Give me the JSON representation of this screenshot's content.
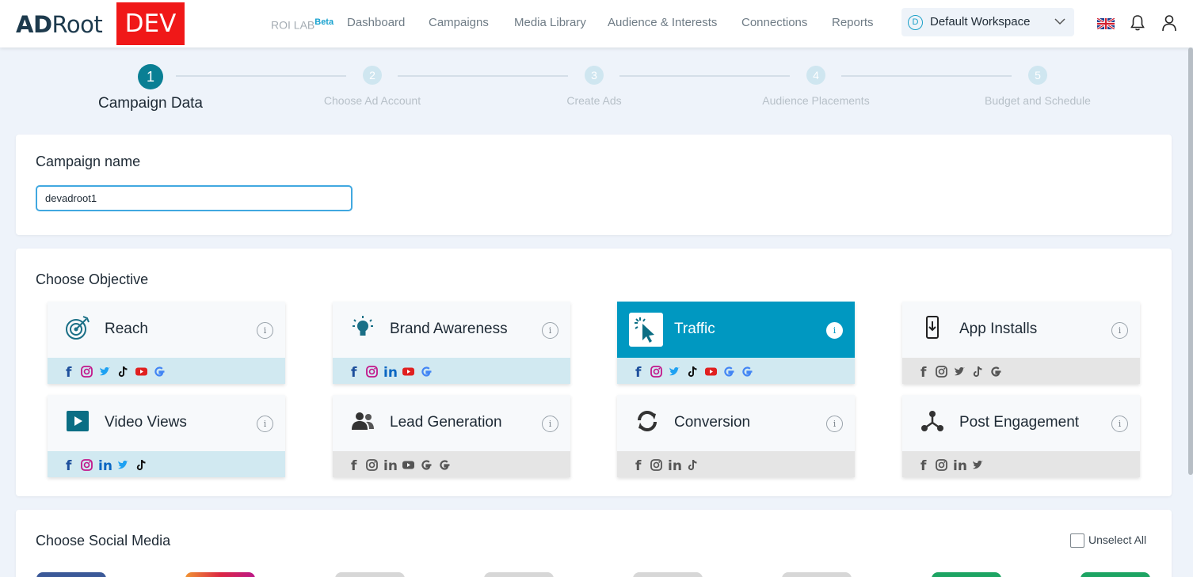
{
  "header": {
    "logo": "ADRoot",
    "env_badge": "DEV",
    "roi_lab": "ROI LAB",
    "roi_lab_badge": "Beta",
    "nav": [
      "Dashboard",
      "Campaigns",
      "Media Library",
      "Audience & Interests",
      "Connections",
      "Reports"
    ],
    "workspace_initial": "D",
    "workspace": "Default Workspace",
    "language_icon": "uk-flag-icon",
    "notifications_icon": "bell-icon",
    "account_icon": "user-icon"
  },
  "stepper": [
    {
      "number": "1",
      "label": "Campaign Data",
      "active": true
    },
    {
      "number": "2",
      "label": "Choose Ad Account",
      "active": false
    },
    {
      "number": "3",
      "label": "Create Ads",
      "active": false
    },
    {
      "number": "4",
      "label": "Audience Placements",
      "active": false
    },
    {
      "number": "5",
      "label": "Budget and Schedule",
      "active": false
    }
  ],
  "campaign_name": {
    "title": "Campaign name",
    "value": "devadroot1"
  },
  "objective": {
    "title": "Choose Objective",
    "info_glyph": "i",
    "items": [
      {
        "label": "Reach",
        "icon": "target-icon",
        "selected": false,
        "platforms": [
          "facebook",
          "instagram",
          "twitter",
          "tiktok",
          "youtube",
          "google"
        ],
        "active": true
      },
      {
        "label": "Brand Awareness",
        "icon": "lightbulb-icon",
        "selected": false,
        "platforms": [
          "facebook",
          "instagram",
          "linkedin",
          "youtube",
          "google"
        ],
        "active": true
      },
      {
        "label": "Traffic",
        "icon": "cursor-click-icon",
        "selected": true,
        "platforms": [
          "facebook",
          "instagram",
          "twitter",
          "tiktok",
          "youtube",
          "google",
          "google"
        ],
        "active": true
      },
      {
        "label": "App Installs",
        "icon": "mobile-download-icon",
        "selected": false,
        "platforms": [
          "facebook",
          "instagram",
          "twitter",
          "tiktok",
          "google"
        ],
        "active": false
      },
      {
        "label": "Video Views",
        "icon": "video-play-icon",
        "selected": false,
        "platforms": [
          "facebook",
          "instagram",
          "linkedin",
          "twitter",
          "tiktok"
        ],
        "active": true
      },
      {
        "label": "Lead Generation",
        "icon": "users-icon",
        "selected": false,
        "platforms": [
          "facebook",
          "instagram",
          "linkedin",
          "youtube",
          "google",
          "google"
        ],
        "active": false
      },
      {
        "label": "Conversion",
        "icon": "sync-icon",
        "selected": false,
        "platforms": [
          "facebook",
          "instagram",
          "linkedin",
          "tiktok"
        ],
        "active": false
      },
      {
        "label": "Post Engagement",
        "icon": "share-nodes-icon",
        "selected": false,
        "platforms": [
          "facebook",
          "instagram",
          "linkedin",
          "twitter"
        ],
        "active": false
      }
    ]
  },
  "social_media": {
    "title": "Choose Social Media",
    "unselect_all": "Unselect All"
  },
  "colors": {
    "accent": "#0098c1",
    "step_active": "#0a7f94",
    "dev_badge": "#f01818"
  }
}
